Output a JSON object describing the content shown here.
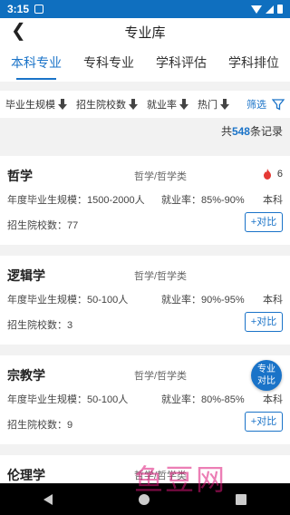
{
  "status_bar": {
    "time": "3:15"
  },
  "header": {
    "title": "专业库",
    "back_glyph": "❮"
  },
  "tabs": [
    {
      "label": "本科专业",
      "active": true
    },
    {
      "label": "专科专业",
      "active": false
    },
    {
      "label": "学科评估",
      "active": false
    },
    {
      "label": "学科排位",
      "active": false
    }
  ],
  "filters": {
    "items": [
      {
        "label": "毕业生规模"
      },
      {
        "label": "招生院校数"
      },
      {
        "label": "就业率"
      },
      {
        "label": "热门"
      }
    ],
    "screen_label": "筛选"
  },
  "summary": {
    "prefix": "共",
    "count": "548",
    "suffix": "条记录"
  },
  "majors": [
    {
      "name": "哲学",
      "category": "哲学/哲学类",
      "scale": "年度毕业生规模：1500-2000人",
      "employment": "就业率：85%-90%",
      "degree": "本科",
      "schools": "招生院校数：77",
      "compare": "+对比",
      "hot": "6"
    },
    {
      "name": "逻辑学",
      "category": "哲学/哲学类",
      "scale": "年度毕业生规模：50-100人",
      "employment": "就业率：90%-95%",
      "degree": "本科",
      "schools": "招生院校数：3",
      "compare": "+对比"
    },
    {
      "name": "宗教学",
      "category": "哲学/哲学类",
      "scale": "年度毕业生规模：50-100人",
      "employment": "就业率：80%-85%",
      "degree": "本科",
      "schools": "招生院校数：9",
      "compare": "+对比"
    },
    {
      "name": "伦理学",
      "category": "哲学/哲学类"
    }
  ],
  "floating": {
    "line1": "专业",
    "line2": "对比"
  },
  "watermark": "鱼豆网",
  "colors": {
    "primary": "#1a73c8",
    "status_bar": "#0f6fbf",
    "hot": "#e53935"
  }
}
